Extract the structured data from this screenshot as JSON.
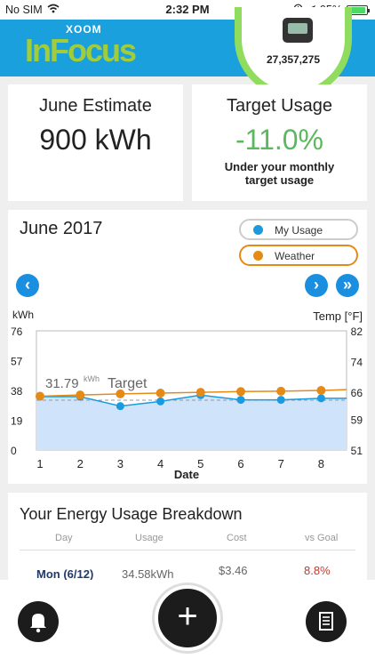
{
  "status_bar": {
    "carrier": "No SIM",
    "time": "2:32 PM",
    "battery": "95%"
  },
  "header": {
    "logo_top": "XOOM",
    "logo_main": "InFocus",
    "device_count": "27,357,275"
  },
  "estimate": {
    "title": "June Estimate",
    "value": "900 kWh"
  },
  "target": {
    "title": "Target Usage",
    "value": "-11.0%",
    "subtitle_line1": "Under your monthly",
    "subtitle_line2": "target usage"
  },
  "chart": {
    "month": "June 2017",
    "legend_usage": "My Usage",
    "legend_weather": "Weather",
    "kwh_label": "kWh",
    "temp_label": "Temp [°F]",
    "target_value": "31.79",
    "target_unit": "kWh",
    "target_label": "Target",
    "xlabel": "Date",
    "nav_prev": "‹",
    "nav_next": "›",
    "nav_last": "»"
  },
  "chart_data": {
    "type": "area",
    "x": [
      1,
      2,
      3,
      4,
      5,
      6,
      7,
      8
    ],
    "series": [
      {
        "name": "My Usage",
        "axis": "kWh",
        "values": [
          34,
          34,
          28,
          31,
          35,
          32,
          32,
          33
        ]
      },
      {
        "name": "Weather",
        "axis": "Temp [°F]",
        "values": [
          65,
          65.3,
          65.6,
          65.8,
          66,
          66.2,
          66.3,
          66.5
        ]
      }
    ],
    "target": 31.79,
    "xlabel": "Date",
    "ylabel_left": "kWh",
    "ylabel_right": "Temp [°F]",
    "ylim_left": [
      0,
      76
    ],
    "yticks_left": [
      0,
      19,
      38,
      57,
      76
    ],
    "ylim_right": [
      51,
      82
    ],
    "yticks_right": [
      51,
      59,
      66,
      74,
      82
    ],
    "colors": {
      "usage": "#1a9be0",
      "usage_fill": "#cfe3fb",
      "weather": "#e58a17",
      "target_line": "#999999"
    }
  },
  "breakdown": {
    "title": "Your Energy Usage Breakdown",
    "columns": [
      "Day",
      "Usage",
      "Cost",
      "vs Goal"
    ],
    "rows": [
      {
        "day": "Mon (6/12)",
        "usage": "34.58kWh",
        "cost": "$3.46",
        "goal": "8.8%"
      }
    ]
  },
  "bottom": {
    "add": "+"
  },
  "colors": {
    "brand_blue": "#1aa0dc",
    "brand_green": "#a2cd3a",
    "positive": "#5cb85c",
    "negative": "#c0392b"
  }
}
